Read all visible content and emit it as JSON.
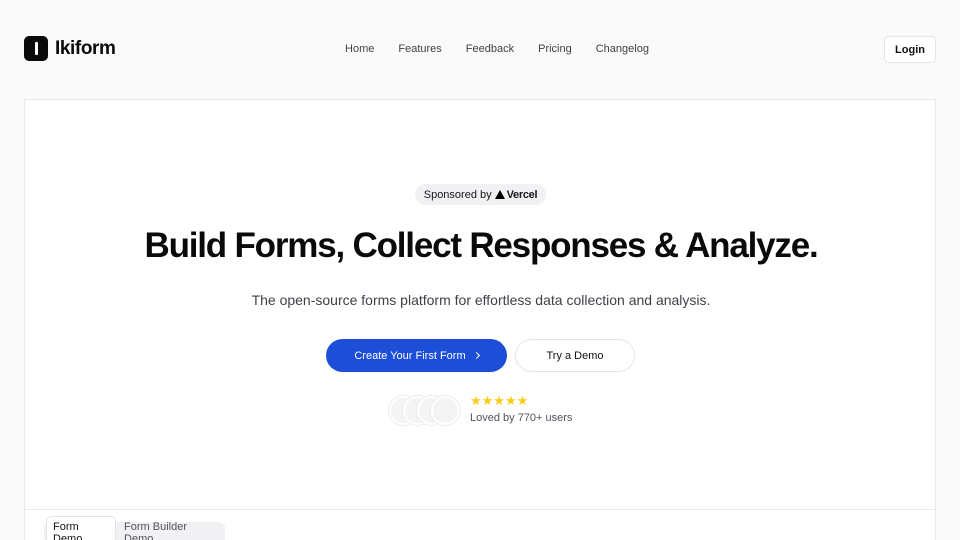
{
  "brand": {
    "name": "Ikiform"
  },
  "nav": {
    "items": [
      "Home",
      "Features",
      "Feedback",
      "Pricing",
      "Changelog"
    ],
    "login_label": "Login"
  },
  "hero": {
    "sponsor_prefix": "Sponsored by",
    "sponsor_name": "Vercel",
    "headline": "Build Forms, Collect Responses & Analyze.",
    "subheadline": "The open-source forms platform for effortless data collection and analysis.",
    "primary_cta": "Create Your First Form",
    "secondary_cta": "Try a Demo",
    "rating": {
      "stars": 5,
      "glyphs": "★★★★★"
    },
    "social_proof": "Loved by 770+ users"
  },
  "demo_tabs": [
    "Form Demo",
    "Form Builder Demo"
  ],
  "colors": {
    "accent": "#1d4ed8",
    "star": "#facc15",
    "background": "#fafafa"
  }
}
